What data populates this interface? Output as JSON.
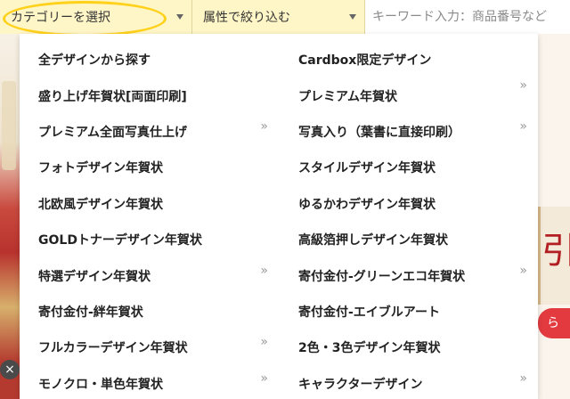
{
  "filter_bar": {
    "category_label": "カテゴリーを選択",
    "attribute_label": "属性で絞り込む",
    "search_placeholder": "キーワード入力：商品番号など"
  },
  "menu": {
    "left": [
      {
        "label": "全デザインから探す",
        "submenu": false
      },
      {
        "label": "盛り上げ年賀状[両面印刷]",
        "submenu": false
      },
      {
        "label": "プレミアム全面写真仕上げ",
        "submenu": true
      },
      {
        "label": "フォトデザイン年賀状",
        "submenu": false
      },
      {
        "label": "北欧風デザイン年賀状",
        "submenu": false
      },
      {
        "label": "GOLDトナーデザイン年賀状",
        "submenu": false
      },
      {
        "label": "特選デザイン年賀状",
        "submenu": true
      },
      {
        "label": "寄付金付-絆年賀状",
        "submenu": false
      },
      {
        "label": "フルカラーデザイン年賀状",
        "submenu": true
      },
      {
        "label": "モノクロ・単色年賀状",
        "submenu": true
      }
    ],
    "right": [
      {
        "label": "Cardbox限定デザイン",
        "submenu": false
      },
      {
        "label": "プレミアム年賀状",
        "submenu": true
      },
      {
        "label": "写真入り（葉書に直接印刷）",
        "submenu": true
      },
      {
        "label": "スタイルデザイン年賀状",
        "submenu": false
      },
      {
        "label": "ゆるかわデザイン年賀状",
        "submenu": false
      },
      {
        "label": "高級箔押しデザイン年賀状",
        "submenu": false
      },
      {
        "label": "寄付金付-グリーンエコ年賀状",
        "submenu": true
      },
      {
        "label": "寄付金付-エイブルアート",
        "submenu": false
      },
      {
        "label": "2色・3色デザイン年賀状",
        "submenu": false
      },
      {
        "label": "キャラクターデザイン",
        "submenu": true
      }
    ],
    "submenu_glyph": "»"
  },
  "background": {
    "right_char": "引",
    "right_button_text": "ら",
    "close_glyph": "×"
  },
  "colors": {
    "bar_bg": "#fff6c7",
    "highlight": "#ffd11a",
    "accent_red": "#e23a3f"
  }
}
